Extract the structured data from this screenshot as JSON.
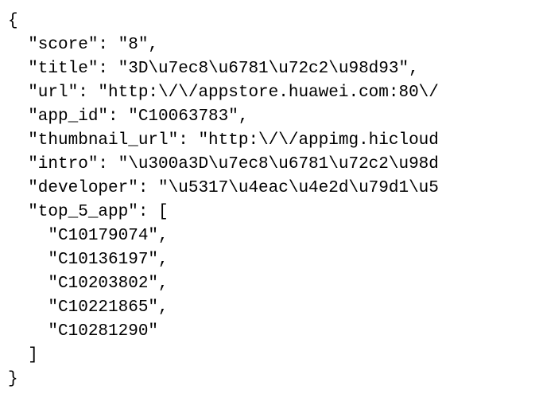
{
  "json_view": {
    "lines": [
      "{",
      "  \"score\": \"8\",",
      "  \"title\": \"3D\\u7ec8\\u6781\\u72c2\\u98d93\",",
      "  \"url\": \"http:\\/\\/appstore.huawei.com:80\\/",
      "  \"app_id\": \"C10063783\",",
      "  \"thumbnail_url\": \"http:\\/\\/appimg.hicloud",
      "  \"intro\": \"\\u300a3D\\u7ec8\\u6781\\u72c2\\u98d",
      "  \"developer\": \"\\u5317\\u4eac\\u4e2d\\u79d1\\u5",
      "  \"top_5_app\": [",
      "    \"C10179074\",",
      "    \"C10136197\",",
      "    \"C10203802\",",
      "    \"C10221865\",",
      "    \"C10281290\"",
      "  ]",
      "}"
    ]
  }
}
